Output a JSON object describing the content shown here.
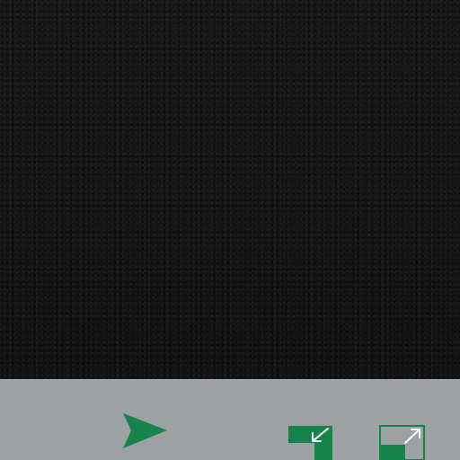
{
  "screen": {
    "name": "video-player-window"
  },
  "viewport": {
    "state": "blank",
    "background_color": "#141517"
  },
  "controls": {
    "accent_color": "#16834a",
    "bar_color": "#9ca1a3",
    "items": [
      {
        "name": "play",
        "icon": "play-icon"
      },
      {
        "name": "shrink",
        "icon": "shrink-window-icon"
      },
      {
        "name": "expand",
        "icon": "expand-window-icon"
      }
    ]
  }
}
